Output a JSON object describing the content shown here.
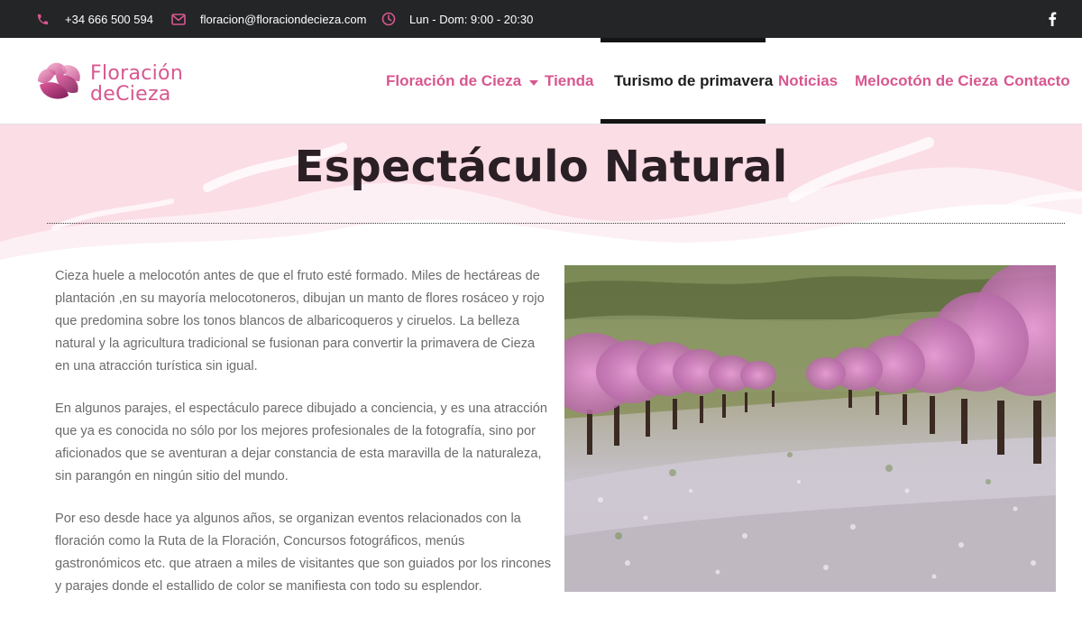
{
  "topbar": {
    "phone": "+34 666 500 594",
    "email": "floracion@floraciondecieza.com",
    "hours": "Lun - Dom: 9:00 - 20:30",
    "icons": {
      "phone": "phone-icon",
      "email": "envelope-icon",
      "hours": "clock-icon",
      "social": "facebook-icon"
    }
  },
  "brand": {
    "line1": "Floración",
    "line2": "deCieza"
  },
  "nav": {
    "items": [
      {
        "label": "Floración de Cieza"
      },
      {
        "label": "Tienda"
      },
      {
        "label": "Turismo de primavera"
      },
      {
        "label": "Noticias"
      },
      {
        "label": "Melocotón de Cieza"
      },
      {
        "label": "Contacto"
      }
    ]
  },
  "main": {
    "title": "Espectáculo Natural",
    "paragraphs": [
      "Cieza huele a melocotón antes de que el fruto esté formado. Miles de hectáreas de plantación ,en su mayoría melocotoneros, dibujan un manto de flores rosáceo y rojo que predomina sobre los tonos blancos de albaricoqueros y ciruelos. La belleza natural y la agricultura tradicional se fusionan para convertir la primavera de Cieza en una atracción turística sin igual.",
      "En algunos parajes, el espectáculo parece dibujado a conciencia, y es una atracción que ya es conocida no sólo por los mejores profesionales de la fotografía, sino por aficionados que se aventuran a dejar constancia de esta maravilla de la naturaleza, sin parangón en ningún sitio del mundo.",
      "Por eso desde hace ya algunos años, se organizan eventos relacionados con la floración como la Ruta de la Floración, Concursos fotográficos, menús gastronómicos etc. que atraen a miles de visitantes que son guiados por los rincones y parajes donde el estallido de color se manifiesta con todo su esplendor."
    ]
  },
  "colors": {
    "accent": "#d8578f",
    "topbar_bg": "#232526",
    "hero_bg": "#fbdde6",
    "text": "#6b6b6b",
    "title": "#2a1f24"
  }
}
